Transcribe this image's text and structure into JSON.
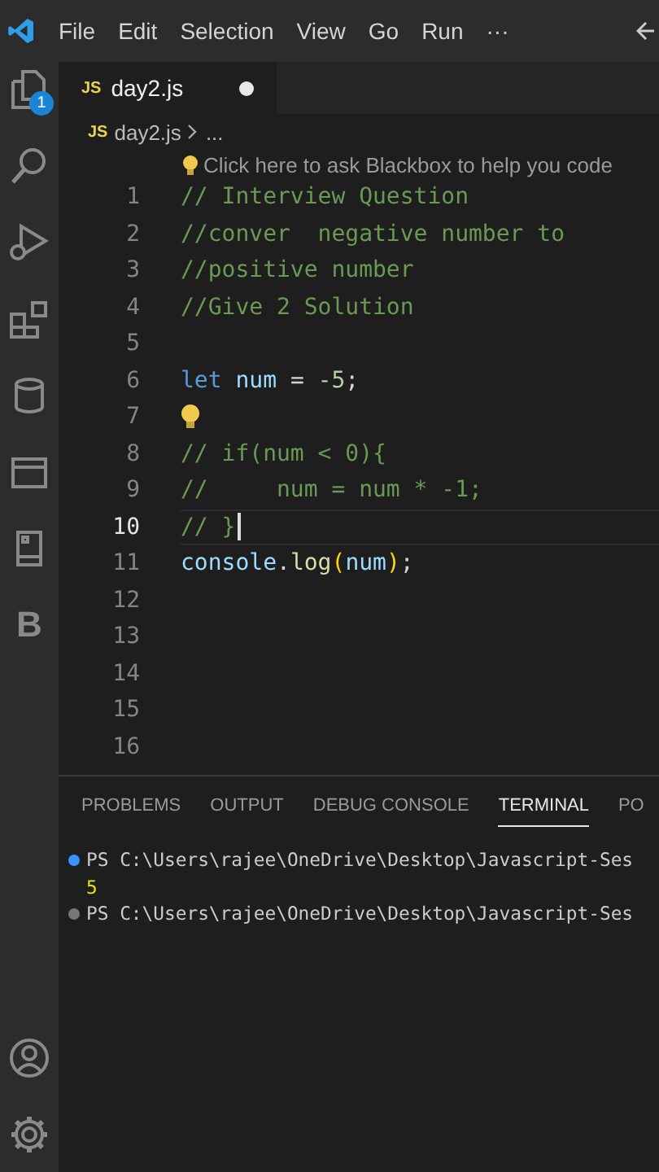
{
  "menu_bar": {
    "items": [
      "File",
      "Edit",
      "Selection",
      "View",
      "Go",
      "Run",
      "···"
    ]
  },
  "activity_bar": {
    "items": [
      {
        "kind": "files",
        "badge": "1"
      },
      {
        "kind": "search"
      },
      {
        "kind": "run"
      },
      {
        "kind": "extensions"
      },
      {
        "kind": "database"
      },
      {
        "kind": "window"
      },
      {
        "kind": "book"
      },
      {
        "kind": "letter",
        "label": "B"
      }
    ],
    "bottom": [
      {
        "kind": "account"
      },
      {
        "kind": "settings"
      }
    ]
  },
  "tabs": [
    {
      "icon": "JS",
      "label": "day2.js",
      "selected": true,
      "modified": true
    }
  ],
  "breadcrumbs": {
    "icon": "JS",
    "items": [
      "day2.js",
      "..."
    ]
  },
  "hint": {
    "text": "Click here to ask Blackbox to help you code"
  },
  "editor": {
    "lines": [
      {
        "number": "1",
        "current": false,
        "lightbulb": false,
        "tokens": [
          {
            "text": "// Interview Question",
            "kind": "comment"
          }
        ]
      },
      {
        "number": "2",
        "current": false,
        "lightbulb": false,
        "tokens": [
          {
            "text": "//conver  negative number to",
            "kind": "comment"
          }
        ]
      },
      {
        "number": "3",
        "current": false,
        "lightbulb": false,
        "tokens": [
          {
            "text": "//positive number",
            "kind": "comment"
          }
        ]
      },
      {
        "number": "4",
        "current": false,
        "lightbulb": false,
        "tokens": [
          {
            "text": "//Give 2 Solution",
            "kind": "comment"
          }
        ]
      },
      {
        "number": "5",
        "current": false,
        "lightbulb": false
      },
      {
        "number": "6",
        "current": false,
        "lightbulb": false,
        "tokens": [
          {
            "text": "let ",
            "kind": "keyword"
          },
          {
            "text": "num",
            "kind": "variable"
          },
          {
            "text": " = ",
            "kind": "plain"
          },
          {
            "text": "-5",
            "kind": "number"
          },
          {
            "text": ";",
            "kind": "plain"
          }
        ]
      },
      {
        "number": "7",
        "current": false,
        "lightbulb": true
      },
      {
        "number": "8",
        "current": false,
        "lightbulb": false,
        "tokens": [
          {
            "text": "// if(num < 0){",
            "kind": "comment"
          }
        ]
      },
      {
        "number": "9",
        "current": false,
        "lightbulb": false,
        "tokens": [
          {
            "text": "//     num = num * -1;",
            "kind": "comment"
          }
        ]
      },
      {
        "number": "10",
        "current": true,
        "lightbulb": false,
        "tokens": [
          {
            "text": "// }",
            "kind": "comment"
          }
        ]
      },
      {
        "number": "11",
        "current": false,
        "lightbulb": false,
        "tokens": [
          {
            "text": "console",
            "kind": "variable"
          },
          {
            "text": ".",
            "kind": "plain"
          },
          {
            "text": "log",
            "kind": "function"
          },
          {
            "text": "(",
            "kind": "paren"
          },
          {
            "text": "num",
            "kind": "variable"
          },
          {
            "text": ")",
            "kind": "paren"
          },
          {
            "text": ";",
            "kind": "plain"
          }
        ]
      },
      {
        "number": "12",
        "current": false,
        "lightbulb": false
      },
      {
        "number": "13",
        "current": false,
        "lightbulb": false
      },
      {
        "number": "14",
        "current": false,
        "lightbulb": false
      },
      {
        "number": "15",
        "current": false,
        "lightbulb": false
      },
      {
        "number": "16",
        "current": false,
        "lightbulb": false
      }
    ]
  },
  "panel": {
    "tabs": [
      {
        "label": "PROBLEMS",
        "selected": false
      },
      {
        "label": "OUTPUT",
        "selected": false
      },
      {
        "label": "DEBUG CONSOLE",
        "selected": false
      },
      {
        "label": "TERMINAL",
        "selected": true
      },
      {
        "label": "PO",
        "selected": false
      }
    ],
    "terminal": [
      {
        "kind": "prompt",
        "color": "#3794ff",
        "text": "PS C:\\Users\\rajee\\OneDrive\\Desktop\\Javascript-Ses"
      },
      {
        "kind": "output",
        "text": "5"
      },
      {
        "kind": "prompt",
        "color": "#777777",
        "text": "PS C:\\Users\\rajee\\OneDrive\\Desktop\\Javascript-Ses"
      }
    ]
  }
}
